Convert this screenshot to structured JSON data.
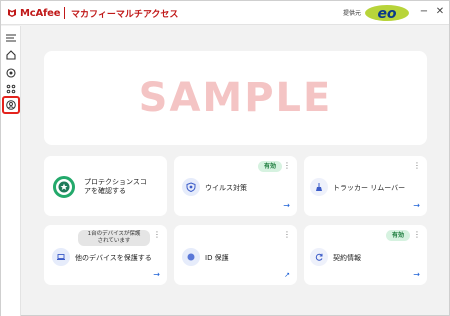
{
  "titlebar": {
    "brand": "McAfee",
    "app_title": "マカフィーマルチアクセス",
    "provider_label": "提供元",
    "provider_logo": "eo",
    "minimize": "−",
    "close": "✕"
  },
  "sidebar": {
    "items": [
      {
        "name": "menu-icon"
      },
      {
        "name": "home-icon"
      },
      {
        "name": "protection-icon"
      },
      {
        "name": "apps-grid-icon"
      },
      {
        "name": "account-icon",
        "highlighted": true
      }
    ]
  },
  "banner": {
    "watermark": "SAMPLE"
  },
  "cards": {
    "protection_score": {
      "title_line1": "プロテクションスコ",
      "title_line2": "アを確認する"
    },
    "antivirus": {
      "badge": "有効",
      "title": "ウイルス対策"
    },
    "tracker": {
      "title": "トラッカー リムーバー"
    },
    "other_devices": {
      "badge_line1": "1台のデバイスが保護",
      "badge_line2": "されています",
      "title": "他のデバイスを保護する"
    },
    "id_protection": {
      "title": "ID 保護"
    },
    "subscription": {
      "badge": "有効",
      "title": "契約情報"
    }
  },
  "colors": {
    "brand_red": "#c01818",
    "highlight_red": "#e3231d",
    "accent_blue": "#1a5fd6",
    "active_green": "#1a7a3a"
  }
}
